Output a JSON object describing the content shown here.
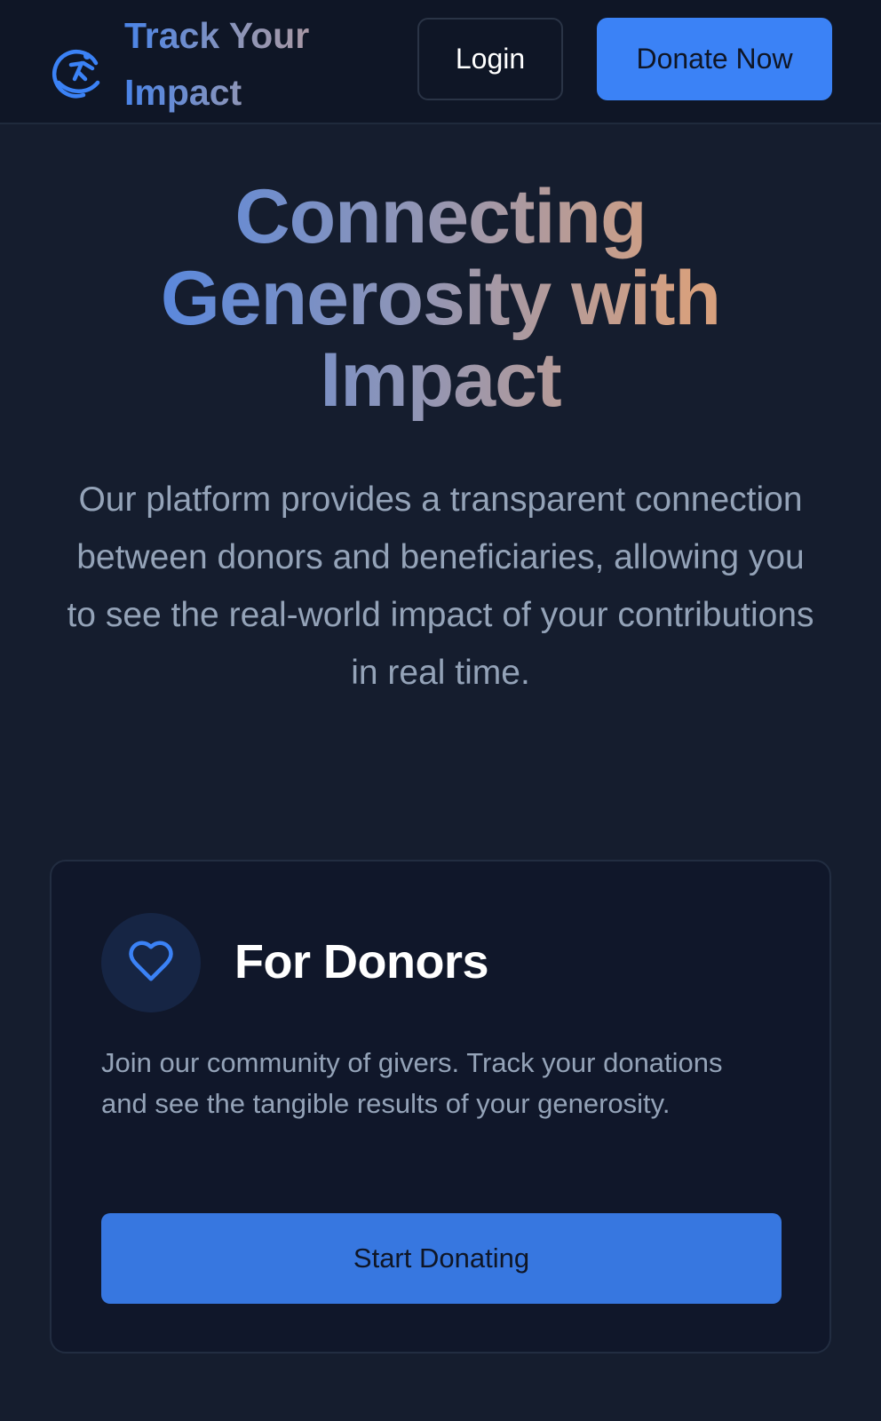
{
  "header": {
    "brand_name": "Track Your Impact",
    "login_label": "Login",
    "donate_label": "Donate Now",
    "logo_icon": "globe-figure-icon"
  },
  "hero": {
    "title": "Connecting Generosity with Impact",
    "description": "Our platform provides a transparent connection between donors and beneficiaries, allowing you to see the real-world impact of your contributions in real time."
  },
  "donor_card": {
    "icon": "heart-icon",
    "title": "For Donors",
    "description": "Join our community of givers. Track your donations and see the tangible results of your generosity.",
    "button_label": "Start Donating"
  },
  "colors": {
    "background": "#151d2e",
    "header_bg": "#0f1626",
    "accent": "#3b82f6",
    "muted_text": "#94a3b8"
  }
}
